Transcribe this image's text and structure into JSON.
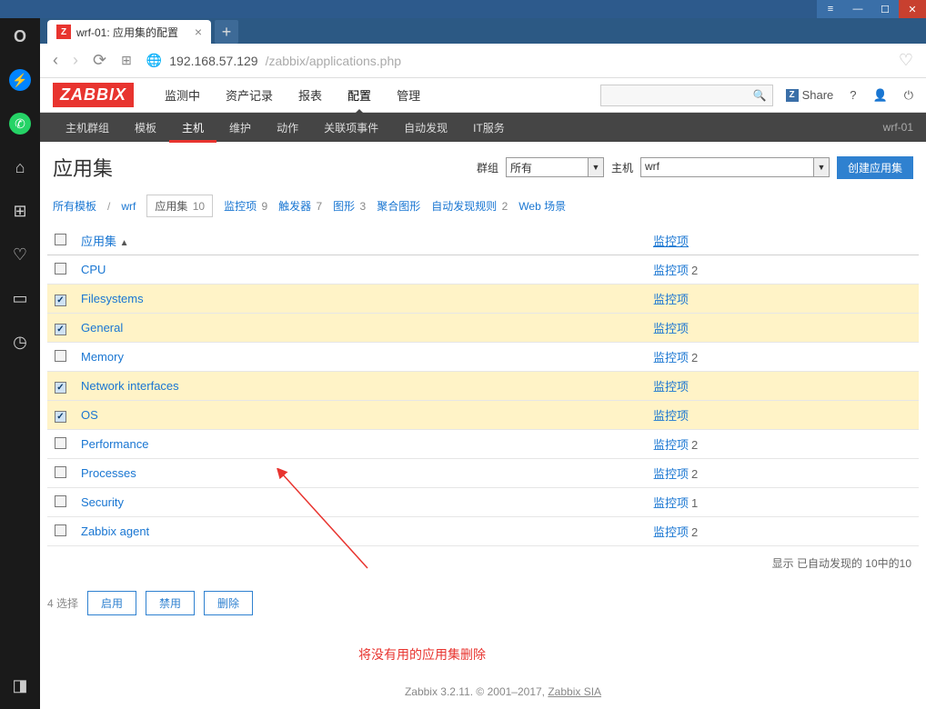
{
  "window_controls": {
    "min": "—",
    "split": "▭",
    "max": "☐",
    "close": "✕"
  },
  "tab": {
    "favicon": "Z",
    "title": "wrf-01: 应用集的配置"
  },
  "addr": {
    "host": "192.168.57.129",
    "path": "/zabbix/applications.php"
  },
  "zabbix": {
    "logo": "ZABBIX",
    "menu": [
      "监测中",
      "资产记录",
      "报表",
      "配置",
      "管理"
    ],
    "active": "配置",
    "share": "Share",
    "sub": [
      "主机群组",
      "模板",
      "主机",
      "维护",
      "动作",
      "关联项事件",
      "自动发现",
      "IT服务"
    ],
    "sub_active": "主机",
    "host_label": "wrf-01"
  },
  "page": {
    "title": "应用集",
    "group_label": "群组",
    "group_value": "所有",
    "host_label": "主机",
    "host_value": "wrf",
    "create_btn": "创建应用集"
  },
  "crumbs": {
    "all_templates": "所有模板",
    "host": "wrf",
    "tabs": [
      {
        "label": "应用集",
        "count": "10",
        "boxed": true
      },
      {
        "label": "监控项",
        "count": "9"
      },
      {
        "label": "触发器",
        "count": "7"
      },
      {
        "label": "图形",
        "count": "3"
      },
      {
        "label": "聚合图形",
        "count": ""
      },
      {
        "label": "自动发现规则",
        "count": "2"
      },
      {
        "label": "Web 场景",
        "count": ""
      }
    ]
  },
  "table": {
    "col_app": "应用集",
    "col_items": "监控项",
    "rows": [
      {
        "name": "CPU",
        "items": "监控项",
        "cnt": "2",
        "sel": false
      },
      {
        "name": "Filesystems",
        "items": "监控项",
        "cnt": "",
        "sel": true
      },
      {
        "name": "General",
        "items": "监控项",
        "cnt": "",
        "sel": true
      },
      {
        "name": "Memory",
        "items": "监控项",
        "cnt": "2",
        "sel": false
      },
      {
        "name": "Network interfaces",
        "items": "监控项",
        "cnt": "",
        "sel": true
      },
      {
        "name": "OS",
        "items": "监控项",
        "cnt": "",
        "sel": true
      },
      {
        "name": "Performance",
        "items": "监控项",
        "cnt": "2",
        "sel": false
      },
      {
        "name": "Processes",
        "items": "监控项",
        "cnt": "2",
        "sel": false
      },
      {
        "name": "Security",
        "items": "监控项",
        "cnt": "1",
        "sel": false
      },
      {
        "name": "Zabbix agent",
        "items": "监控项",
        "cnt": "2",
        "sel": false
      }
    ],
    "footer": "显示 已自动发现的 10中的10"
  },
  "actions": {
    "selected": "4 选择",
    "enable": "启用",
    "disable": "禁用",
    "delete": "删除"
  },
  "annotation": "将没有用的应用集删除",
  "footer": {
    "version": "Zabbix 3.2.11. © 2001–2017, ",
    "link": "Zabbix SIA"
  }
}
